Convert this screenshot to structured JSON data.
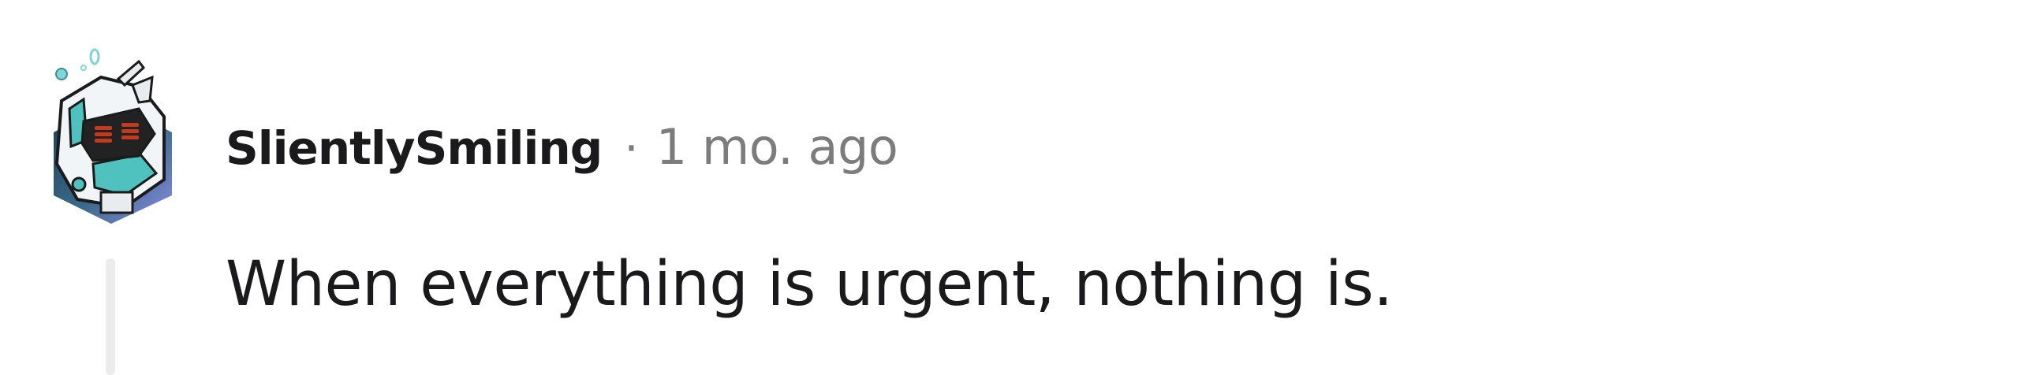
{
  "comment": {
    "author": "SlientlySmiling",
    "separator": "·",
    "timestamp": "1 mo. ago",
    "body": "When everything is urgent, nothing is."
  },
  "avatar": {
    "icon": "robot-avatar-icon",
    "colors": {
      "accent": "#4fc2c0",
      "dark": "#1e3c53",
      "gradient_end": "#8a8be0",
      "eye": "#c33a1f"
    }
  },
  "colors": {
    "text_primary": "#1a1a1c",
    "text_secondary": "#7c7c7c",
    "thread_line": "#ececec"
  }
}
